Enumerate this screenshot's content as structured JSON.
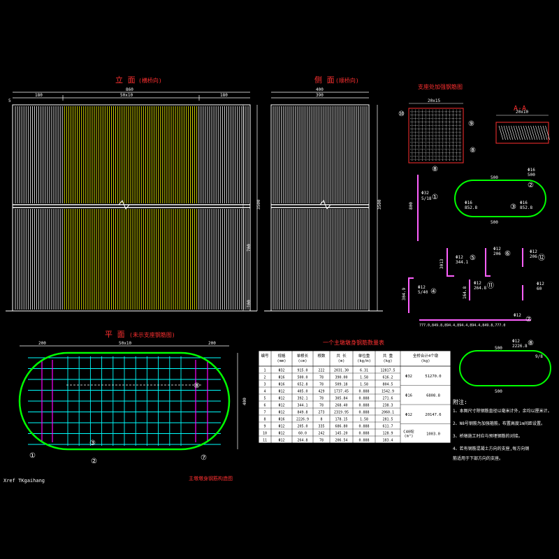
{
  "titles": {
    "elevation": "立 面",
    "elevation_note": "(横桥向)",
    "side": "侧 面",
    "side_note": "(顺桥向)",
    "pier_cap": "支座处加强钢筋图",
    "plan": "平 面",
    "plan_note": "(未示支座钢筋图)",
    "table_title": "一个主墩墩身钢筋数量表",
    "section_aa": "A-A",
    "bottom_caption": "主墩墩身钢筋构造图",
    "xref": "Xref TKgaihang",
    "notes_title": "附注:"
  },
  "dims": {
    "elev_total": "860",
    "elev_left": "180",
    "elev_mid": "50x10",
    "elev_right": "180",
    "elev_edge": "5",
    "side_total": "400",
    "side_seg": "390",
    "height_total": "3500",
    "height_mid": "700",
    "height_bottom": "100",
    "plan_left": "200",
    "plan_mid": "50x10",
    "plan_right": "200",
    "plan_h": "400",
    "cap_w": "20x15",
    "aa_w": "20x10",
    "bar_len_1": "800",
    "bar_h_5": "3013",
    "bar_h_3": "304.9",
    "bar_h_11": "164.8",
    "row_label": "777.0,849.8,894.4,894.4,894.4,849.8,777.0",
    "ring_500_top": "500",
    "ring_500_bot": "500",
    "ring2_500_top": "500",
    "ring2_500_bot": "500",
    "ring2_side": "9/8"
  },
  "callouts": {
    "c10a": "⑩",
    "c9": "⑨",
    "c8": "⑧",
    "c1": "①",
    "c2": "②",
    "c3": "③",
    "c4": "④",
    "c5": "⑤",
    "c6": "⑥",
    "c7": "⑦",
    "c11": "⑪",
    "c12": "⑫"
  },
  "bar_labels": {
    "b1": "Φ32",
    "b1v": "5/18",
    "b3": "Φ16",
    "b3v": "3/18",
    "b4": "Φ12",
    "b4v": "5/40",
    "b5": "Φ12",
    "b5v": "344.1",
    "b6": "Φ12",
    "b6v": "206",
    "b7": "Φ12",
    "b7v": "206.8",
    "b9": "Φ12",
    "b9v": "2226.8",
    "b10": "Φ12",
    "b10v": "60",
    "b11": "Φ12",
    "b11v": "264.8",
    "b12": "Φ12",
    "b12v": "206",
    "ring_a": "Φ16",
    "ring_b": "500",
    "ring_c1": "Φ16",
    "ring_c2": "852.8",
    "ring_d1": "Φ16",
    "ring_d2": "852.8"
  },
  "table": {
    "headers": [
      "编号",
      "规格\n(mm)",
      "单根长\n(cm)",
      "根数",
      "共 长\n(m)",
      "单位重\n(kg/m)",
      "共 重\n(kg)",
      "全桥合计4个墩\n(kg)"
    ],
    "rows": [
      [
        "1",
        "Φ32",
        "915.0",
        "222",
        "2031.30",
        "6.31",
        "12817.5"
      ],
      [
        "2",
        "Φ16",
        "500.0",
        "78",
        "390.00",
        "1.58",
        "616.2"
      ],
      [
        "3",
        "Φ16",
        "652.8",
        "78",
        "509.18",
        "1.58",
        "804.5"
      ],
      [
        "4",
        "Φ12",
        "405.0",
        "429",
        "1737.45",
        "0.888",
        "1542.9"
      ],
      [
        "5",
        "Φ12",
        "392.1",
        "78",
        "305.84",
        "0.888",
        "271.6"
      ],
      [
        "6",
        "Φ12",
        "344.1",
        "78",
        "268.40",
        "0.888",
        "238.3"
      ],
      [
        "7",
        "Φ12",
        "849.8",
        "273",
        "2319.95",
        "0.888",
        "2060.1"
      ],
      [
        "8",
        "Φ16",
        "2226.9",
        "8",
        "178.15",
        "1.58",
        "281.5"
      ],
      [
        "9",
        "Φ12",
        "205.0",
        "335",
        "686.80",
        "0.888",
        "611.7"
      ],
      [
        "10",
        "Φ12",
        "60.0",
        "242",
        "145.20",
        "0.888",
        "128.9"
      ],
      [
        "11",
        "Φ12",
        "264.8",
        "78",
        "206.54",
        "0.888",
        "183.4"
      ]
    ],
    "totals": [
      {
        "label": "Φ32",
        "value": "51270.0"
      },
      {
        "label": "Φ16",
        "value": "6808.8"
      },
      {
        "label": "Φ12",
        "value": "20147.6"
      },
      {
        "label": "C40砼\n(m³)",
        "value": "1003.0"
      }
    ]
  },
  "notes": [
    "1、本图尺寸除钢筋直径以毫米计外，余均以厘米计。",
    "2、N8号钢筋为加强箍筋，布置高度1m间距设置。",
    "3、桥墩施工时应与预埋钢筋的对接。",
    "4、若有钢筋混凝土方向的支座,每方向钢",
    "   筋适用于下部方向的支座。"
  ],
  "colors": {
    "bg": "#000000",
    "white": "#ffffff",
    "yellow": "#ffff00",
    "red": "#ff3030",
    "green": "#00ff00",
    "cyan": "#00ffff",
    "magenta": "#ff00ff",
    "pink": "#ff60ff"
  }
}
